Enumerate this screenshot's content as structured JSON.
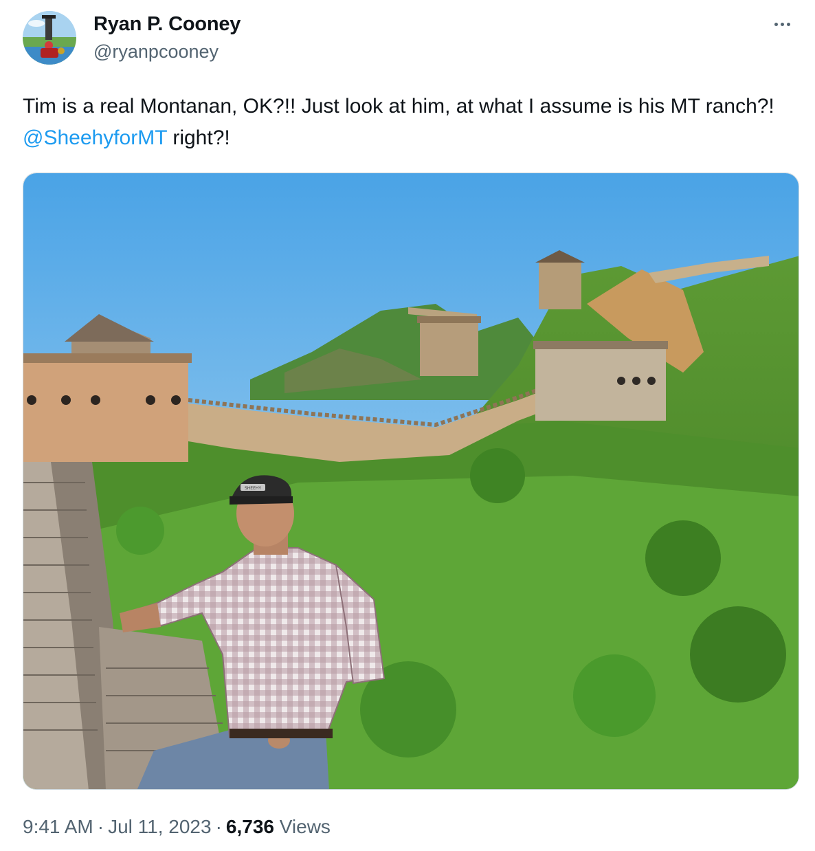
{
  "author": {
    "display_name": "Ryan P. Cooney",
    "handle": "@ryanpcooney",
    "avatar_icon": "avatar-photo"
  },
  "more_icon": "more-options-icon",
  "tweet": {
    "text_before": "Tim is a real Montanan, OK?!! Just look at him, at what I assume is his MT ranch?! ",
    "mention": "@SheehyforMT",
    "text_after": " right?!"
  },
  "media": {
    "cap_text": "SHEEHY"
  },
  "meta": {
    "time": "9:41 AM",
    "date": "Jul 11, 2023",
    "views_count": "6,736",
    "views_label": "Views",
    "separator": "·"
  },
  "colors": {
    "link": "#1d9bf0",
    "secondary_text": "#536471",
    "primary_text": "#0f1419"
  }
}
